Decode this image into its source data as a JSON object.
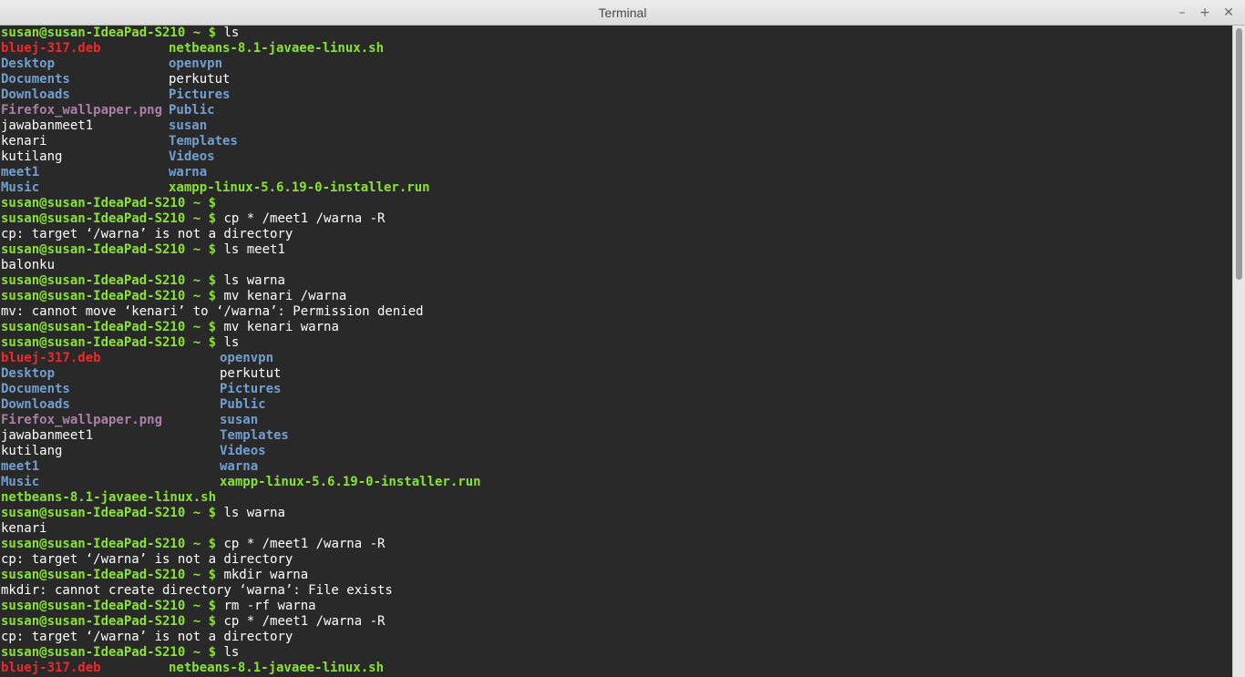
{
  "window": {
    "title": "Terminal",
    "minimize_glyph": "–",
    "maximize_glyph": "+",
    "close_glyph": "✕"
  },
  "colors": {
    "prompt": "#8ae234",
    "directory": "#729fcf",
    "deb_file": "#ef2929",
    "executable": "#8ae234",
    "image": "#ad7fa8",
    "text": "#ffffff"
  },
  "terminal": {
    "lines": [
      {
        "prompt": "susan@susan-IdeaPad-S210 ~ $",
        "cmd": " ls"
      },
      {
        "a": {
          "t": "bluej-317.deb",
          "k": "deb"
        },
        "b": {
          "t": "netbeans-8.1-javaee-linux.sh",
          "k": "exe"
        },
        "col": 185
      },
      {
        "a": {
          "t": "Desktop",
          "k": "dir"
        },
        "b": {
          "t": "openvpn",
          "k": "dir"
        },
        "col": 185
      },
      {
        "a": {
          "t": "Documents",
          "k": "dir"
        },
        "b": {
          "t": "perkutut",
          "k": "file"
        },
        "col": 185
      },
      {
        "a": {
          "t": "Downloads",
          "k": "dir"
        },
        "b": {
          "t": "Pictures",
          "k": "dir"
        },
        "col": 185
      },
      {
        "a": {
          "t": "Firefox_wallpaper.png",
          "k": "img"
        },
        "b": {
          "t": "Public",
          "k": "dir"
        },
        "col": 185
      },
      {
        "a": {
          "t": "jawabanmeet1",
          "k": "file"
        },
        "b": {
          "t": "susan",
          "k": "dir"
        },
        "col": 185
      },
      {
        "a": {
          "t": "kenari",
          "k": "file"
        },
        "b": {
          "t": "Templates",
          "k": "dir"
        },
        "col": 185
      },
      {
        "a": {
          "t": "kutilang",
          "k": "file"
        },
        "b": {
          "t": "Videos",
          "k": "dir"
        },
        "col": 185
      },
      {
        "a": {
          "t": "meet1",
          "k": "dir"
        },
        "b": {
          "t": "warna",
          "k": "dir"
        },
        "col": 185
      },
      {
        "a": {
          "t": "Music",
          "k": "dir"
        },
        "b": {
          "t": "xampp-linux-5.6.19-0-installer.run",
          "k": "exe"
        },
        "col": 185
      },
      {
        "prompt": "susan@susan-IdeaPad-S210 ~ $",
        "cmd": ""
      },
      {
        "prompt": "susan@susan-IdeaPad-S210 ~ $",
        "cmd": " cp * /meet1 /warna -R"
      },
      {
        "out": "cp: target ‘/warna’ is not a directory"
      },
      {
        "prompt": "susan@susan-IdeaPad-S210 ~ $",
        "cmd": " ls meet1"
      },
      {
        "out": "balonku"
      },
      {
        "prompt": "susan@susan-IdeaPad-S210 ~ $",
        "cmd": " ls warna"
      },
      {
        "prompt": "susan@susan-IdeaPad-S210 ~ $",
        "cmd": " mv kenari /warna"
      },
      {
        "out": "mv: cannot move ‘kenari’ to ‘/warna’: Permission denied"
      },
      {
        "prompt": "susan@susan-IdeaPad-S210 ~ $",
        "cmd": " mv kenari warna"
      },
      {
        "prompt": "susan@susan-IdeaPad-S210 ~ $",
        "cmd": " ls"
      },
      {
        "a": {
          "t": "bluej-317.deb",
          "k": "deb"
        },
        "b": {
          "t": "openvpn",
          "k": "dir"
        },
        "col": 241
      },
      {
        "a": {
          "t": "Desktop",
          "k": "dir"
        },
        "b": {
          "t": "perkutut",
          "k": "file"
        },
        "col": 241
      },
      {
        "a": {
          "t": "Documents",
          "k": "dir"
        },
        "b": {
          "t": "Pictures",
          "k": "dir"
        },
        "col": 241
      },
      {
        "a": {
          "t": "Downloads",
          "k": "dir"
        },
        "b": {
          "t": "Public",
          "k": "dir"
        },
        "col": 241
      },
      {
        "a": {
          "t": "Firefox_wallpaper.png",
          "k": "img"
        },
        "b": {
          "t": "susan",
          "k": "dir"
        },
        "col": 241
      },
      {
        "a": {
          "t": "jawabanmeet1",
          "k": "file"
        },
        "b": {
          "t": "Templates",
          "k": "dir"
        },
        "col": 241
      },
      {
        "a": {
          "t": "kutilang",
          "k": "file"
        },
        "b": {
          "t": "Videos",
          "k": "dir"
        },
        "col": 241
      },
      {
        "a": {
          "t": "meet1",
          "k": "dir"
        },
        "b": {
          "t": "warna",
          "k": "dir"
        },
        "col": 241
      },
      {
        "a": {
          "t": "Music",
          "k": "dir"
        },
        "b": {
          "t": "xampp-linux-5.6.19-0-installer.run",
          "k": "exe"
        },
        "col": 241
      },
      {
        "a": {
          "t": "netbeans-8.1-javaee-linux.sh",
          "k": "exe"
        }
      },
      {
        "prompt": "susan@susan-IdeaPad-S210 ~ $",
        "cmd": " ls warna"
      },
      {
        "out": "kenari"
      },
      {
        "prompt": "susan@susan-IdeaPad-S210 ~ $",
        "cmd": " cp * /meet1 /warna -R"
      },
      {
        "out": "cp: target ‘/warna’ is not a directory"
      },
      {
        "prompt": "susan@susan-IdeaPad-S210 ~ $",
        "cmd": " mkdir warna"
      },
      {
        "out": "mkdir: cannot create directory ‘warna’: File exists"
      },
      {
        "prompt": "susan@susan-IdeaPad-S210 ~ $",
        "cmd": " rm -rf warna"
      },
      {
        "prompt": "susan@susan-IdeaPad-S210 ~ $",
        "cmd": " cp * /meet1 /warna -R"
      },
      {
        "out": "cp: target ‘/warna’ is not a directory"
      },
      {
        "prompt": "susan@susan-IdeaPad-S210 ~ $",
        "cmd": " ls"
      },
      {
        "a": {
          "t": "bluej-317.deb",
          "k": "deb"
        },
        "b": {
          "t": "netbeans-8.1-javaee-linux.sh",
          "k": "exe"
        },
        "col": 185
      }
    ]
  }
}
